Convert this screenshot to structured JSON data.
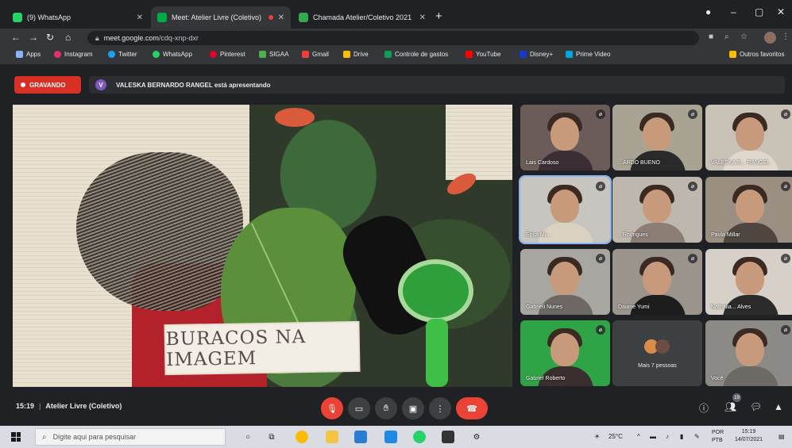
{
  "browser": {
    "tabs": [
      {
        "label": "(9) WhatsApp",
        "color": "#25d366"
      },
      {
        "label": "Meet: Atelier Livre (Coletivo)",
        "color": "#00ac47"
      },
      {
        "label": "Chamada Atelier/Coletivo 2021",
        "color": "#34a853"
      }
    ],
    "new_tab": "+",
    "window_controls": [
      "●",
      "–",
      "▢",
      "✕"
    ],
    "url_host": "meet.google.com",
    "url_path": "/cdq-xnp-dxr",
    "bookmarks": [
      {
        "label": "Apps",
        "color": "#8ab4f8"
      },
      {
        "label": "Instagram",
        "color": "#e1306c"
      },
      {
        "label": "Twitter",
        "color": "#1da1f2"
      },
      {
        "label": "WhatsApp",
        "color": "#25d366"
      },
      {
        "label": "Pinterest",
        "color": "#e60023"
      },
      {
        "label": "SIGAA",
        "color": "#4caf50"
      },
      {
        "label": "Gmail",
        "color": "#ea4335"
      },
      {
        "label": "Drive",
        "color": "#fbbc04"
      },
      {
        "label": "Controle de gastos",
        "color": "#0f9d58"
      },
      {
        "label": "YouTube",
        "color": "#ff0000"
      },
      {
        "label": "Disney+",
        "color": "#113ccf"
      },
      {
        "label": "Prime Video",
        "color": "#00a8e1"
      }
    ],
    "other_bookmarks": "Outros favoritos"
  },
  "meet": {
    "recording_label": "GRAVANDO",
    "presenter_initial": "V",
    "presenting_text": "VALESKA BERNARDO RANGEL está apresentando",
    "presentation_caption": "BURACOS NA IMAGEM",
    "participants": [
      {
        "name": "Lais Cardoso",
        "bg": "#6b5b59",
        "shirt": "#3b2f35"
      },
      {
        "name": "...ARDO BUENO",
        "bg": "#a9a394",
        "shirt": "#2a2a2a"
      },
      {
        "name": "VALESKA B... RANGEL",
        "bg": "#c9c2b6",
        "shirt": "#e0d8cc"
      },
      {
        "name": "Érica Mi...",
        "bg": "#c8c4bf",
        "shirt": "#d9d2c2"
      },
      {
        "name": "...Rodrigues",
        "bg": "#bdb7ad",
        "shirt": "#8c7e74"
      },
      {
        "name": "Paula Millar",
        "bg": "#9b8f82",
        "shirt": "#4f473f"
      },
      {
        "name": "Gabrieli Nunes",
        "bg": "#a8a6a1",
        "shirt": "#6d6863"
      },
      {
        "name": "Daiane Yumi",
        "bg": "#9a948c",
        "shirt": "#1d1d1d"
      },
      {
        "name": "Nathalia... Alves",
        "bg": "#d6d0c8",
        "shirt": "#2b2b2b"
      },
      {
        "name": "Gabriel Roberto",
        "bg": "#2ea447",
        "shirt": "#3a2e2e"
      },
      {
        "name": "Você",
        "bg": "#8c8a86",
        "shirt": "#6d6a66"
      }
    ],
    "others_label": "Mais 7 pessoas",
    "time": "15:19",
    "meeting_name": "Atelier Livre (Coletivo)",
    "participants_badge": "19"
  },
  "taskbar": {
    "search_placeholder": "Digite aqui para pesquisar",
    "weather": "25°C",
    "lang_top": "POR",
    "lang_bottom": "PTB",
    "clock_time": "15:19",
    "clock_date": "14/07/2021"
  }
}
